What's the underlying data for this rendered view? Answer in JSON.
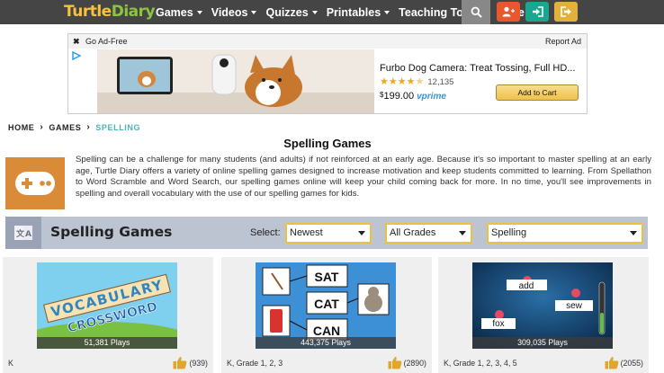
{
  "header": {
    "logo_part1": "Turtle",
    "logo_part2": "Diary",
    "menu": [
      {
        "label": "Games"
      },
      {
        "label": "Videos"
      },
      {
        "label": "Quizzes"
      },
      {
        "label": "Printables"
      },
      {
        "label": "Teaching Tools"
      },
      {
        "label": "More"
      }
    ],
    "icons": {
      "search": "search-icon",
      "signup": "add-user-icon",
      "login": "sign-in-icon",
      "logout": "sign-out-icon"
    },
    "colors": {
      "bar": "#454545",
      "signup": "#e8582c",
      "login": "#19a88e",
      "logout": "#e2b13c"
    }
  },
  "ad": {
    "close_label": "✖",
    "go_ad_free": "Go Ad-Free",
    "report": "Report Ad",
    "product_title": "Furbo Dog Camera: Treat Tossing, Full HD...",
    "rating_stars": 4.5,
    "reviews": "12,135",
    "price_symbol": "$",
    "price": "199.00",
    "prime": "vprime",
    "cart_button": "Add to Cart"
  },
  "breadcrumb": {
    "home": "HOME",
    "games": "GAMES",
    "current": "SPELLING"
  },
  "page": {
    "title": "Spelling Games",
    "intro": "Spelling can be a challenge for many students (and adults) if not reinforced at an early age. Because it's so important to master spelling at an early age, Turtle Diary offers a variety of online spelling games designed to increase motivation and keep students committed to learning. From Spellathon to Word Scramble and Word Search, our spelling games online will keep your child coming back for more. In no time, you'll see improvements in spelling and overall vocabulary with the use of our spelling games for kids."
  },
  "filter": {
    "title": "Spelling Games",
    "select_label": "Select:",
    "sort": "Newest",
    "grade": "All Grades",
    "category": "Spelling"
  },
  "games": [
    {
      "plays": "51,381 Plays",
      "grade": "K",
      "likes": "(939)",
      "thumb_words": [
        "VOCABULARY",
        "CROSSWORD"
      ]
    },
    {
      "plays": "443,375 Plays",
      "grade": "K, Grade 1, 2, 3",
      "likes": "(2890)",
      "thumb_words": [
        "SAT",
        "CAT",
        "CAN"
      ]
    },
    {
      "plays": "309,035 Plays",
      "grade": "K, Grade 1, 2, 3, 4, 5",
      "likes": "(2055)",
      "thumb_words": [
        "add",
        "sew",
        "fox"
      ]
    }
  ]
}
